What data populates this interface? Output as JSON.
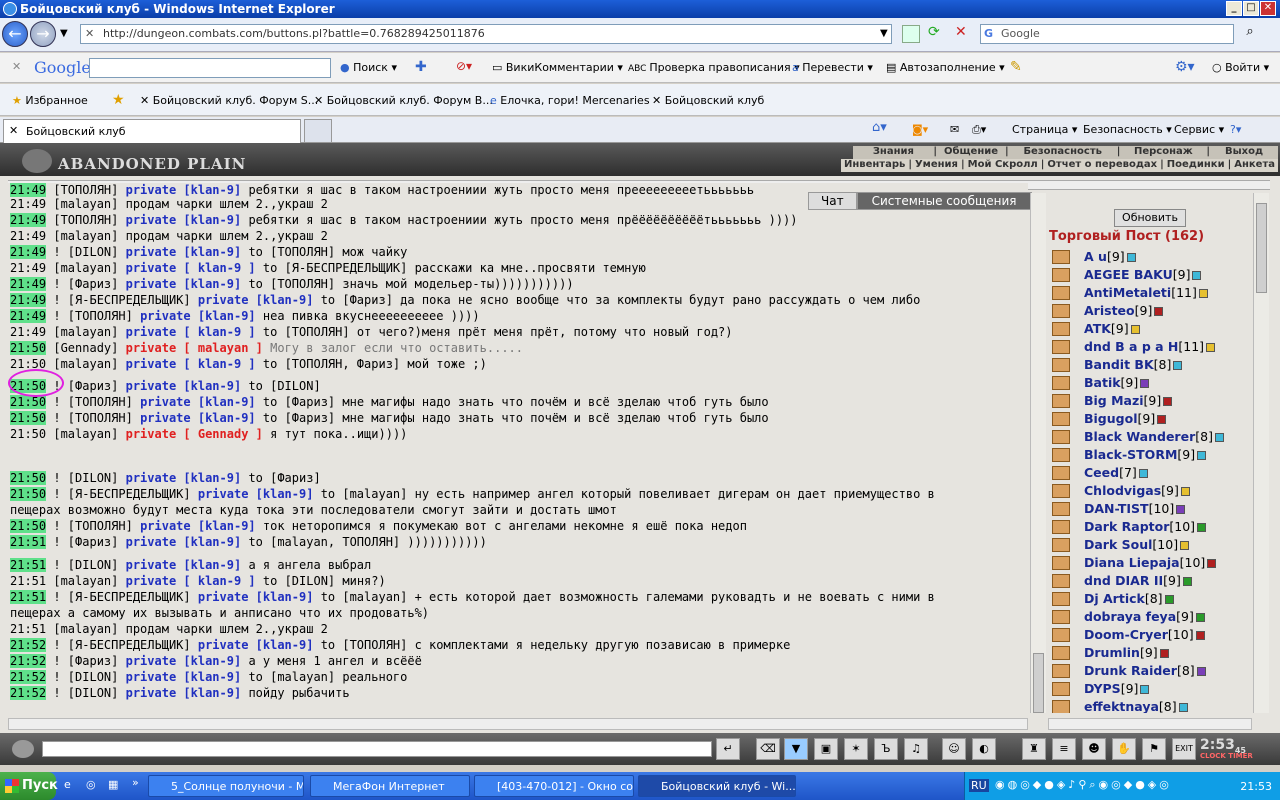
{
  "window": {
    "title": "Бойцовский клуб - Windows Internet Explorer"
  },
  "nav": {
    "url": "http://dungeon.combats.com/buttons.pl?battle=0.768289425011876",
    "search_placeholder": "Google"
  },
  "google_bar": {
    "logo": "Google",
    "items": [
      "Поиск",
      "ВикиКомментарии",
      "Проверка правописания",
      "Перевести",
      "Автозаполнение",
      "Войти"
    ]
  },
  "favorites": {
    "label": "Избранное",
    "items": [
      "Бойцовский клуб. Форум S...",
      "Бойцовский клуб. Форум В...",
      "Елочка, гори! Mercenaries",
      "Бойцовский клуб"
    ]
  },
  "tabs": {
    "active_tab": "Бойцовский клуб",
    "commands": [
      "Страница",
      "Безопасность",
      "Сервис"
    ]
  },
  "game": {
    "logo": "ABANDONED PLAIN",
    "menu_top": [
      "Знания",
      "Общение",
      "Безопасность",
      "Персонаж",
      "Выход"
    ],
    "menu_bottom": [
      "Инвентарь",
      "Умения",
      "Мой Скролл",
      "Отчет о переводах",
      "Поединки",
      "Анкета"
    ],
    "chat_tabs": [
      "Чат",
      "Системные сообщения"
    ],
    "refresh_label": "Обновить",
    "post_title": "Торговый Пост (162)"
  },
  "chat_lines": [
    {
      "time": "21:49",
      "hl": true,
      "sender": "ТОПОЛЯН",
      "priv": "private [klan-9]",
      "privColor": "blue",
      "to": "",
      "text": "ребятки я шас в таком настроениии жуть просто меня прееееееееетььььььь"
    },
    {
      "time": "21:49",
      "hl": false,
      "sender": "malayan",
      "priv": "",
      "privColor": "",
      "to": "",
      "text": "продам чарки шлем 2.,украш 2"
    },
    {
      "time": "21:49",
      "hl": true,
      "sender": "ТОПОЛЯН",
      "priv": "private [klan-9]",
      "privColor": "blue",
      "to": "",
      "text": "ребятки я шас в таком настроениии жуть просто меня прёёёёёёёёёётььььььь ))))"
    },
    {
      "time": "21:49",
      "hl": false,
      "sender": "malayan",
      "priv": "",
      "privColor": "",
      "to": "",
      "text": "продам чарки шлем 2.,украш 2"
    },
    {
      "time": "21:49",
      "hl": true,
      "sender": "DILON",
      "priv": "private [klan-9]",
      "privColor": "blue",
      "to": "to [ТОПОЛЯН]",
      "text": "мож чайку",
      "excl": true
    },
    {
      "time": "21:49",
      "hl": false,
      "sender": "malayan",
      "priv": "private [ klan-9 ]",
      "privColor": "blue",
      "to": "to [Я-БЕСПРЕДЕЛЬЩИК]",
      "text": "расскажи ка мне..просвяти темную"
    },
    {
      "time": "21:49",
      "hl": true,
      "sender": "Фариз",
      "priv": "private [klan-9]",
      "privColor": "blue",
      "to": "to [ТОПОЛЯН]",
      "text": "значь мой модельер-ты)))))))))))",
      "excl": true
    },
    {
      "time": "21:49",
      "hl": true,
      "sender": "Я-БЕСПРЕДЕЛЬЩИК",
      "priv": "private [klan-9]",
      "privColor": "blue",
      "to": "to [Фариз]",
      "text": "да пока не ясно вообще что за комплекты будут рано рассуждать о чем либо",
      "excl": true
    },
    {
      "time": "21:49",
      "hl": true,
      "sender": "ТОПОЛЯН",
      "priv": "private [klan-9]",
      "privColor": "blue",
      "to": "",
      "text": "неа пивка вкуснееееееееее ))))",
      "excl": true
    },
    {
      "time": "21:49",
      "hl": false,
      "sender": "malayan",
      "priv": "private [ klan-9 ]",
      "privColor": "blue",
      "to": "to [ТОПОЛЯН]",
      "text": "от чего?)меня прёт меня прёт, потому что новый год?)"
    },
    {
      "time": "21:50",
      "hl": true,
      "sender": "Gennady",
      "priv": "private [ malayan ]",
      "privColor": "red",
      "to": "",
      "text": "Могу в залог если что оставить.....",
      "gray": true
    },
    {
      "time": "21:50",
      "hl": false,
      "sender": "malayan",
      "priv": "private [ klan-9 ]",
      "privColor": "blue",
      "to": "to [ТОПОЛЯН, Фариз]",
      "text": "мой тоже ;)"
    },
    {
      "time": "21:50",
      "hl": true,
      "sender": "Фариз",
      "priv": "private [klan-9]",
      "privColor": "blue",
      "to": "to [DILON]",
      "text": "",
      "excl": true
    },
    {
      "time": "21:50",
      "hl": true,
      "sender": "ТОПОЛЯН",
      "priv": "private [klan-9]",
      "privColor": "blue",
      "to": "to [Фариз]",
      "text": "мне магифы надо знать что почём и всё зделаю чтоб гуть было",
      "excl": true
    },
    {
      "time": "21:50",
      "hl": true,
      "sender": "ТОПОЛЯН",
      "priv": "private [klan-9]",
      "privColor": "blue",
      "to": "to [Фариз]",
      "text": "мне магифы надо знать что почём и всё зделаю чтоб гуть было",
      "excl": true
    },
    {
      "time": "21:50",
      "hl": false,
      "sender": "malayan",
      "priv": "private [ Gennady ]",
      "privColor": "red",
      "to": "",
      "text": "я тут пока..ищи))))"
    },
    {
      "time": "21:50",
      "hl": true,
      "sender": "DILON",
      "priv": "private [klan-9]",
      "privColor": "blue",
      "to": "to [Фариз]",
      "text": "",
      "excl": true
    },
    {
      "time": "21:50",
      "hl": true,
      "sender": "Я-БЕСПРЕДЕЛЬЩИК",
      "priv": "private [klan-9]",
      "privColor": "blue",
      "to": "to [malayan]",
      "text": "ну есть например ангел который повеливает дигерам он дает приемущество в",
      "excl": true
    },
    {
      "time": "",
      "hl": false,
      "sender": "",
      "priv": "",
      "privColor": "",
      "to": "",
      "text": "пещерах возможно будут места куда тока эти последователи смогут зайти и достать шмот",
      "cont": true
    },
    {
      "time": "21:50",
      "hl": true,
      "sender": "ТОПОЛЯН",
      "priv": "private [klan-9]",
      "privColor": "blue",
      "to": "",
      "text": "ток неторопимся я покумекаю вот с ангелами некомне я ешё пока недоп",
      "excl": true
    },
    {
      "time": "21:51",
      "hl": true,
      "sender": "Фариз",
      "priv": "private [klan-9]",
      "privColor": "blue",
      "to": "to [malayan, ТОПОЛЯН]",
      "text": ")))))))))))",
      "excl": true
    },
    {
      "time": "21:51",
      "hl": true,
      "sender": "DILON",
      "priv": "private [klan-9]",
      "privColor": "blue",
      "to": "",
      "text": "а я ангела выбрал",
      "excl": true
    },
    {
      "time": "21:51",
      "hl": false,
      "sender": "malayan",
      "priv": "private [ klan-9 ]",
      "privColor": "blue",
      "to": "to [DILON]",
      "text": "миня?)"
    },
    {
      "time": "21:51",
      "hl": true,
      "sender": "Я-БЕСПРЕДЕЛЬЩИК",
      "priv": "private [klan-9]",
      "privColor": "blue",
      "to": "to [malayan]",
      "text": "+ есть которой дает возможность галемами руковадть и не воевать с ними в",
      "excl": true
    },
    {
      "time": "",
      "hl": false,
      "sender": "",
      "priv": "",
      "privColor": "",
      "to": "",
      "text": "пещерах а самому их вызывать и анписано что их продовать%)",
      "cont": true
    },
    {
      "time": "21:51",
      "hl": false,
      "sender": "malayan",
      "priv": "",
      "privColor": "",
      "to": "",
      "text": "продам чарки шлем 2.,украш 2"
    },
    {
      "time": "21:52",
      "hl": true,
      "sender": "Я-БЕСПРЕДЕЛЬЩИК",
      "priv": "private [klan-9]",
      "privColor": "blue",
      "to": "to [ТОПОЛЯН]",
      "text": "с комплектами я недельку другую позависаю в примерке",
      "excl": true
    },
    {
      "time": "21:52",
      "hl": true,
      "sender": "Фариз",
      "priv": "private [klan-9]",
      "privColor": "blue",
      "to": "",
      "text": "а у меня 1 ангел и всёёё",
      "excl": true
    },
    {
      "time": "21:52",
      "hl": true,
      "sender": "DILON",
      "priv": "private [klan-9]",
      "privColor": "blue",
      "to": "to [malayan]",
      "text": "реального",
      "excl": true
    },
    {
      "time": "21:52",
      "hl": true,
      "sender": "DILON",
      "priv": "private [klan-9]",
      "privColor": "blue",
      "to": "",
      "text": "пойду рыбачить",
      "excl": true
    }
  ],
  "players": [
    {
      "name": "A u",
      "level": "[9]",
      "infoColor": "#3fb8d8"
    },
    {
      "name": "AEGEE BAKU",
      "level": "[9]",
      "infoColor": "#3fb8d8"
    },
    {
      "name": "AntiMetaleti",
      "level": "[11]",
      "infoColor": "#e6c030"
    },
    {
      "name": "Aristeo",
      "level": "[9]",
      "infoColor": "#b02020"
    },
    {
      "name": "ATK",
      "level": "[9]",
      "infoColor": "#e6c030"
    },
    {
      "name": "dnd В а р а Н",
      "level": "[11]",
      "infoColor": "#e6c030"
    },
    {
      "name": "Bandit BK",
      "level": "[8]",
      "infoColor": "#3fb8d8"
    },
    {
      "name": "Batik",
      "level": "[9]",
      "infoColor": "#7a3fb8"
    },
    {
      "name": "Big Mazi",
      "level": "[9]",
      "infoColor": "#b02020"
    },
    {
      "name": "Bigugol",
      "level": "[9]",
      "infoColor": "#b02020"
    },
    {
      "name": "Black Wanderer",
      "level": "[8]",
      "infoColor": "#3fb8d8"
    },
    {
      "name": "Black-STORM",
      "level": "[9]",
      "infoColor": "#3fb8d8"
    },
    {
      "name": "Ceed",
      "level": "[7]",
      "infoColor": "#3fb8d8"
    },
    {
      "name": "Chlodvigas",
      "level": "[9]",
      "infoColor": "#e6c030"
    },
    {
      "name": "DAN-TIST",
      "level": "[10]",
      "infoColor": "#7a3fb8"
    },
    {
      "name": "Dark Raptor",
      "level": "[10]",
      "infoColor": "#2a9a2a"
    },
    {
      "name": "Dark Soul",
      "level": "[10]",
      "infoColor": "#e6c030"
    },
    {
      "name": "Diana Liepaja",
      "level": "[10]",
      "infoColor": "#b02020"
    },
    {
      "name": "dnd DIAR II",
      "level": "[9]",
      "infoColor": "#2a9a2a"
    },
    {
      "name": "Dj Artick",
      "level": "[8]",
      "infoColor": "#2a9a2a"
    },
    {
      "name": "dobraya feya",
      "level": "[9]",
      "infoColor": "#2a9a2a"
    },
    {
      "name": "Doom-Cryer",
      "level": "[10]",
      "infoColor": "#b02020"
    },
    {
      "name": "Drumlin",
      "level": "[9]",
      "infoColor": "#b02020"
    },
    {
      "name": "Drunk Raider",
      "level": "[8]",
      "infoColor": "#7a3fb8"
    },
    {
      "name": "DYPS",
      "level": "[9]",
      "infoColor": "#3fb8d8"
    },
    {
      "name": "effektnaya",
      "level": "[8]",
      "infoColor": "#3fb8d8"
    }
  ],
  "clock": {
    "time": "2:53",
    "sec": "45",
    "labels": "CLOCK TIMER"
  },
  "taskbar": {
    "start": "Пуск",
    "tasks": [
      "5_Солнце полуночи - Mi...",
      "МегаФон Интернет",
      "[403-470-012] - Окно со...",
      "Бойцовский клуб - Wi..."
    ],
    "lang": "RU",
    "time": "21:53"
  }
}
